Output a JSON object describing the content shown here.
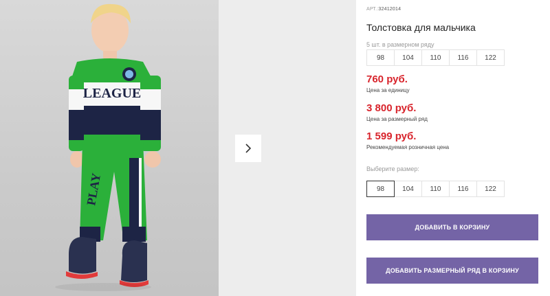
{
  "gallery": {
    "photo_alt": "boy in sweatshirt and joggers",
    "next_icon": "chevron-right-icon"
  },
  "product": {
    "art_label": "АРТ.:",
    "art_number": "32412014",
    "title": "Толстовка для мальчика",
    "row_note": "5 шт. в размерном ряду",
    "size_row": [
      "98",
      "104",
      "110",
      "116",
      "122"
    ],
    "prices": [
      {
        "value": "760 руб.",
        "label": "Цена за единицу"
      },
      {
        "value": "3 800 руб.",
        "label": "Цена за размерный ряд"
      },
      {
        "value": "1 599 руб.",
        "label": "Рекомендуемая розничная цена"
      }
    ],
    "choose_label": "Выберите размер:",
    "sizes": [
      "98",
      "104",
      "110",
      "116",
      "122"
    ],
    "selected_size": "98",
    "add_button": "ДОБАВИТЬ В КОРЗИНУ",
    "add_row_button": "ДОБАВИТЬ РАЗМЕРНЫЙ РЯД В КОРЗИНУ"
  },
  "colors": {
    "price": "#d8242c",
    "button": "#7464a6",
    "jersey_green": "#2bb03a",
    "jersey_navy": "#1d2445"
  }
}
